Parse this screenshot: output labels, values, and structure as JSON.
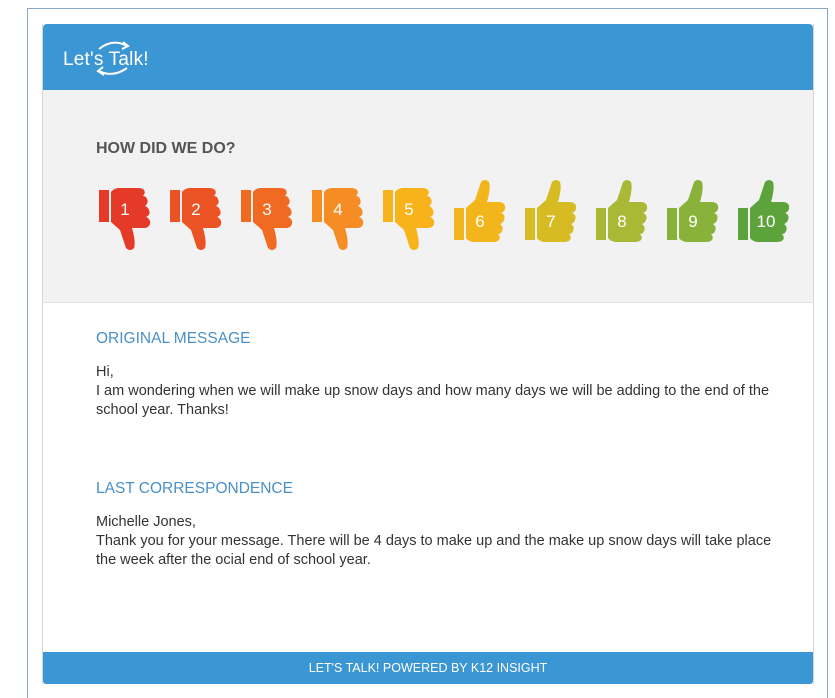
{
  "header": {
    "logo_text": "Let's Talk!"
  },
  "rating": {
    "title": "HOW DID WE DO?",
    "options": [
      {
        "label": "1",
        "color": "#e53a27",
        "direction": "down"
      },
      {
        "label": "2",
        "color": "#ec5324",
        "direction": "down"
      },
      {
        "label": "3",
        "color": "#f16a21",
        "direction": "down"
      },
      {
        "label": "4",
        "color": "#f58d24",
        "direction": "down"
      },
      {
        "label": "5",
        "color": "#f8b21a",
        "direction": "down"
      },
      {
        "label": "6",
        "color": "#f2b51b",
        "direction": "up"
      },
      {
        "label": "7",
        "color": "#d7bb22",
        "direction": "up"
      },
      {
        "label": "8",
        "color": "#a9b936",
        "direction": "up"
      },
      {
        "label": "9",
        "color": "#89b23a",
        "direction": "up"
      },
      {
        "label": "10",
        "color": "#5da33c",
        "direction": "up"
      }
    ]
  },
  "original_message": {
    "title": "ORIGINAL MESSAGE",
    "greeting": "Hi,",
    "body": "I am wondering when we will make up snow days and how many days we will be adding to the end of the school year. Thanks!"
  },
  "last_correspondence": {
    "title": "LAST CORRESPONDENCE",
    "greeting": "Michelle Jones,",
    "body": "Thank you for your message. There will be 4 days to make up and the make up snow days will take place the week after the ocial end of school year."
  },
  "footer": {
    "text": "LET'S TALK! POWERED BY K12 INSIGHT"
  },
  "colors": {
    "brand_blue": "#3b96d4",
    "section_title": "#4a90c8"
  }
}
